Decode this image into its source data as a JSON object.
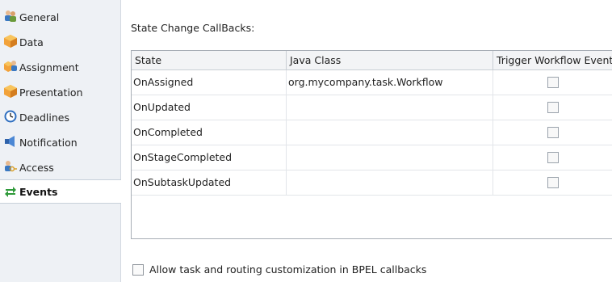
{
  "sidebar": {
    "items": [
      {
        "label": "General",
        "icon": "people-icon"
      },
      {
        "label": "Data",
        "icon": "cube-icon"
      },
      {
        "label": "Assignment",
        "icon": "assignment-icon"
      },
      {
        "label": "Presentation",
        "icon": "cube-icon"
      },
      {
        "label": "Deadlines",
        "icon": "clock-icon"
      },
      {
        "label": "Notification",
        "icon": "notification-icon"
      },
      {
        "label": "Access",
        "icon": "key-people-icon"
      },
      {
        "label": "Events",
        "icon": "events-arrows-icon",
        "selected": true
      }
    ]
  },
  "main": {
    "section_title": "State Change CallBacks:",
    "table": {
      "columns": [
        "State",
        "Java Class",
        "Trigger Workflow Event"
      ],
      "rows": [
        {
          "state": "OnAssigned",
          "java_class": "org.mycompany.task.Workflow",
          "trigger": false
        },
        {
          "state": "OnUpdated",
          "java_class": "",
          "trigger": false
        },
        {
          "state": "OnCompleted",
          "java_class": "",
          "trigger": false
        },
        {
          "state": "OnStageCompleted",
          "java_class": "",
          "trigger": false
        },
        {
          "state": "OnSubtaskUpdated",
          "java_class": "",
          "trigger": false
        }
      ]
    },
    "bottom_option": {
      "label": "Allow task and routing customization in BPEL callbacks",
      "checked": false
    }
  },
  "colors": {
    "sidebar_bg": "#eef1f5",
    "selected_bg": "#ffffff",
    "grid_border": "#a8aeb6",
    "events_icon": "#2f9a3a"
  }
}
